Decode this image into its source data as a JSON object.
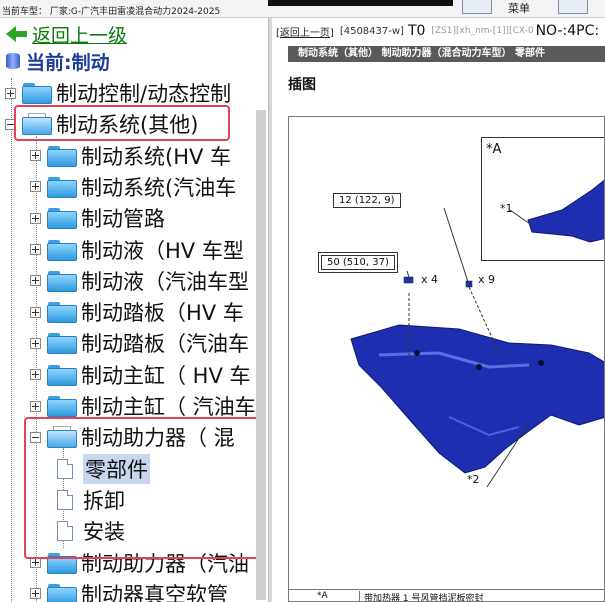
{
  "topbar": {
    "car_info": "当前车型： 厂家:G-广汽丰田雷凌混合动力2024-2025",
    "menu_label": "菜单"
  },
  "tree": {
    "back_label": "返回上一级",
    "current_label": "当前:制动",
    "nodes": [
      {
        "label": "制动控制/动态控制",
        "type": "folder",
        "expander": "plus"
      },
      {
        "label": "制动系统(其他)",
        "type": "folder-open",
        "expander": "minus"
      },
      {
        "label": "制动系统(HV 车",
        "type": "folder",
        "expander": "plus"
      },
      {
        "label": "制动系统(汽油车",
        "type": "folder",
        "expander": "plus"
      },
      {
        "label": "制动管路",
        "type": "folder",
        "expander": "plus"
      },
      {
        "label": "制动液（HV 车型",
        "type": "folder",
        "expander": "plus"
      },
      {
        "label": "制动液（汽油车型",
        "type": "folder",
        "expander": "plus"
      },
      {
        "label": "制动踏板（HV 车",
        "type": "folder",
        "expander": "plus"
      },
      {
        "label": "制动踏板（汽油车",
        "type": "folder",
        "expander": "plus"
      },
      {
        "label": "制动主缸（ HV 车",
        "type": "folder",
        "expander": "plus"
      },
      {
        "label": "制动主缸（ 汽油车",
        "type": "folder",
        "expander": "plus"
      },
      {
        "label": "制动助力器（ 混",
        "type": "folder-open",
        "expander": "minus"
      },
      {
        "label": "零部件",
        "type": "doc",
        "selected": true
      },
      {
        "label": "拆卸",
        "type": "doc"
      },
      {
        "label": "安装",
        "type": "doc"
      },
      {
        "label": "制动助力器（汽油",
        "type": "folder",
        "expander": "plus"
      },
      {
        "label": "制动器真空软管",
        "type": "folder",
        "expander": "plus"
      }
    ]
  },
  "content": {
    "back_link": "[返回上一页]",
    "code": "[4508437-w]",
    "t0": "T0",
    "gray_text": "[ZS1][xh_nm-[1]][CX-0",
    "nos": "NO-:4PC:",
    "title": "制动系统（其他） 制动助力器（混合动力车型） 零部件",
    "section": "插图",
    "figure": {
      "inset_label": "*A",
      "callouts": [
        {
          "id": "c1",
          "text": "12 (122, 9)"
        },
        {
          "id": "c2",
          "text": "50 (510, 37)"
        }
      ],
      "labels": {
        "star1": "*1",
        "star2": "*2",
        "x4": "x 4",
        "x9": "x 9"
      },
      "legend_key": "*A",
      "legend_value": "带加热器 1 号风管挡泥板密封"
    }
  },
  "colors": {
    "accent_green": "#2aa52a",
    "tree_title_blue": "#1b3c9a",
    "highlight_red": "#e0435a",
    "part_blue": "#1d2fb0"
  }
}
